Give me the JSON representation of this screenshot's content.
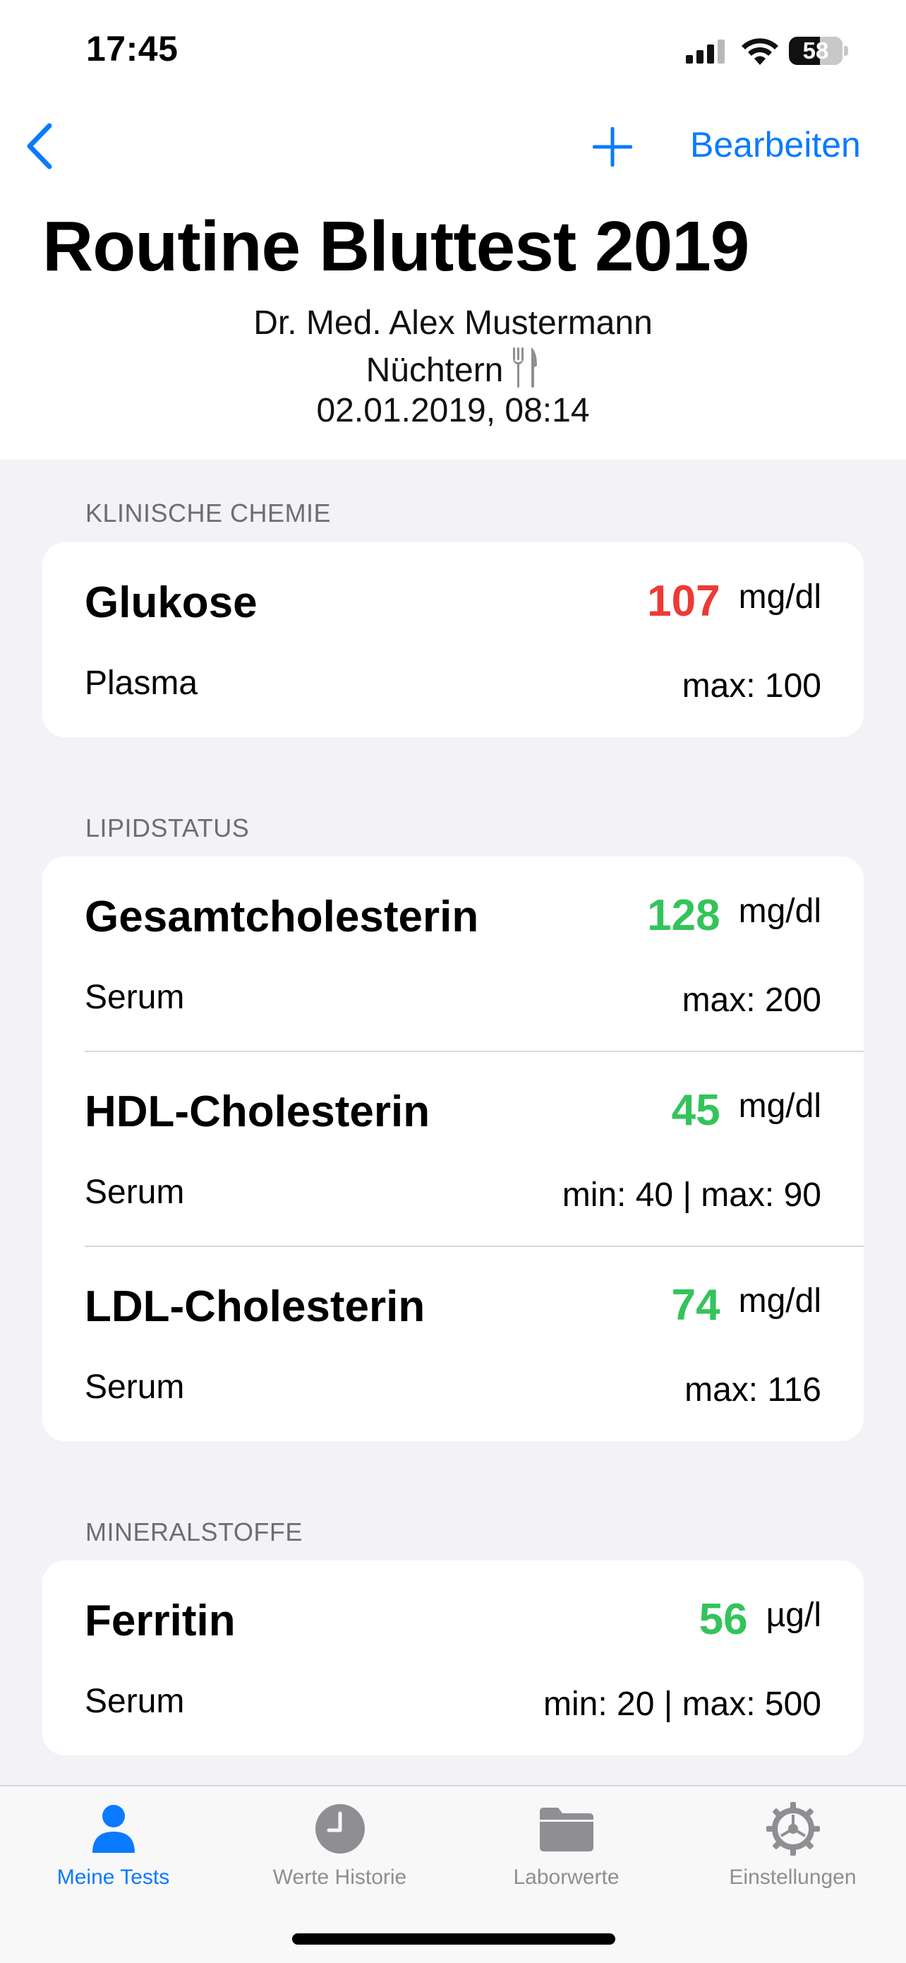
{
  "status_bar": {
    "time": "17:45",
    "battery": "58"
  },
  "nav": {
    "edit_label": "Bearbeiten"
  },
  "header": {
    "title": "Routine Bluttest 2019",
    "doctor": "Dr. Med. Alex Mustermann",
    "fasting": "Nüchtern",
    "datetime": "02.01.2019, 08:14"
  },
  "sections": [
    {
      "label": "KLINISCHE CHEMIE",
      "items": [
        {
          "name": "Glukose",
          "sample": "Plasma",
          "value": "107",
          "unit": "mg/dl",
          "range": "max: 100",
          "status": "high"
        }
      ]
    },
    {
      "label": "LIPIDSTATUS",
      "items": [
        {
          "name": "Gesamtcholesterin",
          "sample": "Serum",
          "value": "128",
          "unit": "mg/dl",
          "range": "max: 200",
          "status": "normal"
        },
        {
          "name": "HDL-Cholesterin",
          "sample": "Serum",
          "value": "45",
          "unit": "mg/dl",
          "range": "min: 40 | max: 90",
          "status": "normal"
        },
        {
          "name": "LDL-Cholesterin",
          "sample": "Serum",
          "value": "74",
          "unit": "mg/dl",
          "range": "max: 116",
          "status": "normal"
        }
      ]
    },
    {
      "label": "MINERALSTOFFE",
      "items": [
        {
          "name": "Ferritin",
          "sample": "Serum",
          "value": "56",
          "unit": "µg/l",
          "range": "min: 20 | max: 500",
          "status": "normal"
        }
      ]
    }
  ],
  "tabs": [
    {
      "label": "Meine Tests",
      "icon": "person-icon",
      "active": true
    },
    {
      "label": "Werte Historie",
      "icon": "clock-icon",
      "active": false
    },
    {
      "label": "Laborwerte",
      "icon": "folder-icon",
      "active": false
    },
    {
      "label": "Einstellungen",
      "icon": "gear-icon",
      "active": false
    }
  ],
  "colors": {
    "accent": "#0a7aff",
    "high": "#ee3a36",
    "normal": "#34c35b",
    "tab_inactive": "#8e8e93",
    "background": "#f2f2f7"
  }
}
